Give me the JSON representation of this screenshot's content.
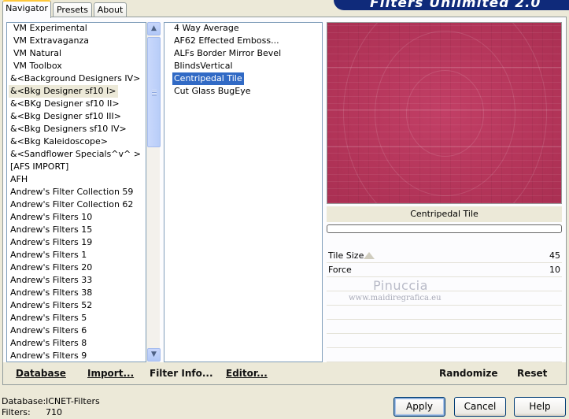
{
  "banner": {
    "title": "Filters Unlimited 2.0"
  },
  "tabs": [
    {
      "label": "Navigator"
    },
    {
      "label": "Presets"
    },
    {
      "label": "About"
    }
  ],
  "categories": [
    "VM Experimental",
    "VM Extravaganza",
    "VM Natural",
    "VM Toolbox",
    "&<Background Designers IV>",
    "&<Bkg Designer sf10 I>",
    "&<BKg Designer sf10 II>",
    "&<Bkg Designer sf10 III>",
    "&<Bkg Designers sf10 IV>",
    "&<Bkg Kaleidoscope>",
    "&<Sandflower Specials^v^ >",
    "[AFS IMPORT]",
    "AFH",
    "Andrew's Filter Collection 59",
    "Andrew's Filter Collection 62",
    "Andrew's Filters 10",
    "Andrew's Filters 15",
    "Andrew's Filters 19",
    "Andrew's Filters 1",
    "Andrew's Filters 20",
    "Andrew's Filters 33",
    "Andrew's Filters 38",
    "Andrew's Filters 52",
    "Andrew's Filters 5",
    "Andrew's Filters 6",
    "Andrew's Filters 8",
    "Andrew's Filters 9"
  ],
  "filters": [
    "4 Way Average",
    "AF62 Effected Emboss...",
    "ALFs Border Mirror Bevel",
    "BlindsVertical",
    "Centripedal Tile",
    "Cut Glass  BugEye"
  ],
  "preview": {
    "filter_name": "Centripedal Tile",
    "progress": 0
  },
  "params": [
    {
      "label": "Tile Size",
      "value": "45"
    },
    {
      "label": "Force",
      "value": "10"
    }
  ],
  "watermark": {
    "line1": "Pinuccia",
    "line2": "www.maidiregrafica.eu"
  },
  "toolbar": {
    "database": "Database",
    "import": "Import...",
    "filter_info": "Filter Info...",
    "editor": "Editor...",
    "randomize": "Randomize",
    "reset": "Reset"
  },
  "status": {
    "database_label": "Database:",
    "database_value": "ICNET-Filters",
    "filters_label": "Filters:",
    "filters_value": "710"
  },
  "buttons": {
    "apply": "Apply",
    "cancel": "Cancel",
    "help": "Help"
  }
}
